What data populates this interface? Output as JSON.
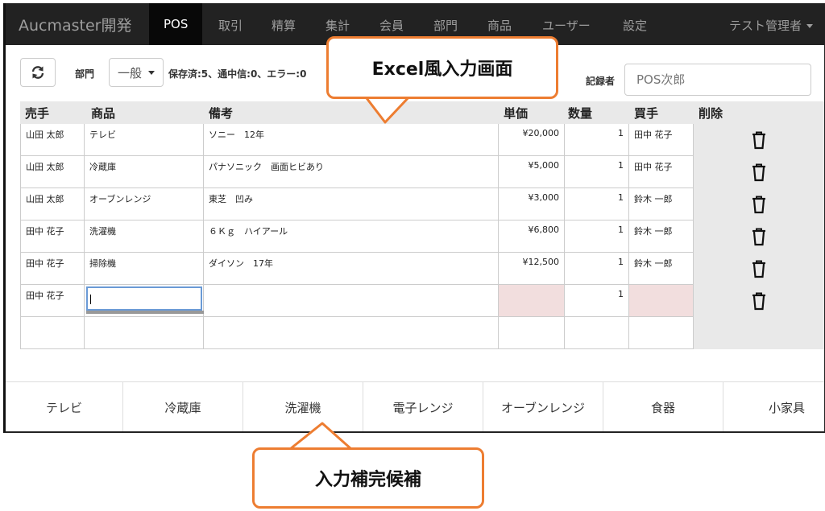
{
  "nav": {
    "brand": "Aucmaster開発",
    "items": [
      "POS",
      "取引",
      "精算",
      "集計",
      "会員",
      "部門",
      "商品",
      "ユーザー",
      "設定"
    ],
    "active": "POS",
    "user": "テスト管理者"
  },
  "toolbar": {
    "bumon_label": "部門",
    "bumon_value": "一般",
    "status": "保存済:5、通中信:0、エラー:0",
    "recorder_label": "記録者",
    "recorder_placeholder": "POS次郎"
  },
  "table": {
    "headers": [
      "売手",
      "商品",
      "備考",
      "単価",
      "数量",
      "買手",
      "削除"
    ],
    "rows": [
      {
        "seller": "山田 太郎",
        "item": "テレビ",
        "note": "ソニー　12年",
        "price": "¥20,000",
        "qty": "1",
        "buyer": "田中 花子"
      },
      {
        "seller": "山田 太郎",
        "item": "冷蔵庫",
        "note": "パナソニック　画面ヒビあり",
        "price": "¥5,000",
        "qty": "1",
        "buyer": "田中 花子"
      },
      {
        "seller": "山田 太郎",
        "item": "オーブンレンジ",
        "note": "東芝　凹み",
        "price": "¥3,000",
        "qty": "1",
        "buyer": "鈴木 一郎"
      },
      {
        "seller": "田中 花子",
        "item": "洗濯機",
        "note": "６Ｋｇ　ハイアール",
        "price": "¥6,800",
        "qty": "1",
        "buyer": "鈴木 一郎"
      },
      {
        "seller": "田中 花子",
        "item": "掃除機",
        "note": "ダイソン　17年",
        "price": "¥12,500",
        "qty": "1",
        "buyer": "鈴木 一郎"
      },
      {
        "seller": "田中 花子",
        "item": "",
        "note": "",
        "price": "",
        "qty": "1",
        "buyer": ""
      }
    ]
  },
  "candidates": [
    "テレビ",
    "冷蔵庫",
    "洗濯機",
    "電子レンジ",
    "オーブンレンジ",
    "食器",
    "小家具"
  ],
  "callouts": {
    "top": "Excel風入力画面",
    "bottom": "入力補完候補"
  },
  "colors": {
    "callout_border": "#ed7d31",
    "nav_bg": "#222222",
    "warn_bg": "#f2dede"
  },
  "icons": {
    "refresh": "refresh-icon",
    "delete": "trash-icon"
  }
}
